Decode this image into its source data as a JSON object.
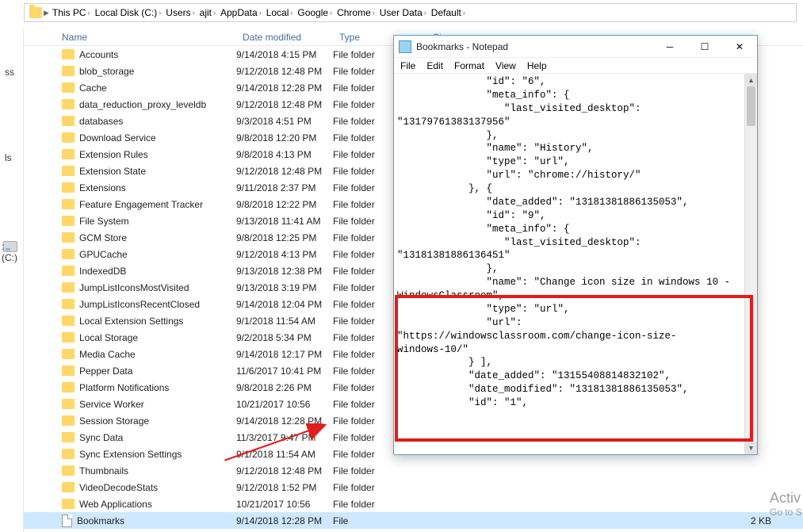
{
  "breadcrumb": {
    "items": [
      {
        "label": "This PC"
      },
      {
        "label": "Local Disk (C:)"
      },
      {
        "label": "Users"
      },
      {
        "label": "ajit"
      },
      {
        "label": "AppData"
      },
      {
        "label": "Local"
      },
      {
        "label": "Google"
      },
      {
        "label": "Chrome"
      },
      {
        "label": "User Data"
      },
      {
        "label": "Default"
      }
    ]
  },
  "sidebar": {
    "labels": {
      "ss": "ss",
      "ls": "ls",
      "cdisk": ": (C:)"
    }
  },
  "columns": {
    "name": "Name",
    "date": "Date modified",
    "type": "Type",
    "size": "Size"
  },
  "files": [
    {
      "icon": "folder",
      "name": "Accounts",
      "date": "9/14/2018 4:15 PM",
      "type": "File folder",
      "size": ""
    },
    {
      "icon": "folder",
      "name": "blob_storage",
      "date": "9/12/2018 12:48 PM",
      "type": "File folder",
      "size": ""
    },
    {
      "icon": "folder",
      "name": "Cache",
      "date": "9/14/2018 12:28 PM",
      "type": "File folder",
      "size": ""
    },
    {
      "icon": "folder",
      "name": "data_reduction_proxy_leveldb",
      "date": "9/12/2018 12:48 PM",
      "type": "File folder",
      "size": ""
    },
    {
      "icon": "folder",
      "name": "databases",
      "date": "9/3/2018 4:51 PM",
      "type": "File folder",
      "size": ""
    },
    {
      "icon": "folder",
      "name": "Download Service",
      "date": "9/8/2018 12:20 PM",
      "type": "File folder",
      "size": ""
    },
    {
      "icon": "folder",
      "name": "Extension Rules",
      "date": "9/8/2018 4:13 PM",
      "type": "File folder",
      "size": ""
    },
    {
      "icon": "folder",
      "name": "Extension State",
      "date": "9/12/2018 12:48 PM",
      "type": "File folder",
      "size": ""
    },
    {
      "icon": "folder",
      "name": "Extensions",
      "date": "9/11/2018 2:37 PM",
      "type": "File folder",
      "size": ""
    },
    {
      "icon": "folder",
      "name": "Feature Engagement Tracker",
      "date": "9/8/2018 12:22 PM",
      "type": "File folder",
      "size": ""
    },
    {
      "icon": "folder",
      "name": "File System",
      "date": "9/13/2018 11:41 AM",
      "type": "File folder",
      "size": ""
    },
    {
      "icon": "folder",
      "name": "GCM Store",
      "date": "9/8/2018 12:25 PM",
      "type": "File folder",
      "size": ""
    },
    {
      "icon": "folder",
      "name": "GPUCache",
      "date": "9/12/2018 4:13 PM",
      "type": "File folder",
      "size": ""
    },
    {
      "icon": "folder",
      "name": "IndexedDB",
      "date": "9/13/2018 12:38 PM",
      "type": "File folder",
      "size": ""
    },
    {
      "icon": "folder",
      "name": "JumpListIconsMostVisited",
      "date": "9/13/2018 3:19 PM",
      "type": "File folder",
      "size": ""
    },
    {
      "icon": "folder",
      "name": "JumpListIconsRecentClosed",
      "date": "9/14/2018 12:04 PM",
      "type": "File folder",
      "size": ""
    },
    {
      "icon": "folder",
      "name": "Local Extension Settings",
      "date": "9/1/2018 11:54 AM",
      "type": "File folder",
      "size": ""
    },
    {
      "icon": "folder",
      "name": "Local Storage",
      "date": "9/2/2018 5:34 PM",
      "type": "File folder",
      "size": ""
    },
    {
      "icon": "folder",
      "name": "Media Cache",
      "date": "9/14/2018 12:17 PM",
      "type": "File folder",
      "size": ""
    },
    {
      "icon": "folder",
      "name": "Pepper Data",
      "date": "11/6/2017 10:41 PM",
      "type": "File folder",
      "size": ""
    },
    {
      "icon": "folder",
      "name": "Platform Notifications",
      "date": "9/8/2018 2:26 PM",
      "type": "File folder",
      "size": ""
    },
    {
      "icon": "folder",
      "name": "Service Worker",
      "date": "10/21/2017 10:56",
      "type": "File folder",
      "size": ""
    },
    {
      "icon": "folder",
      "name": "Session Storage",
      "date": "9/14/2018 12:28 PM",
      "type": "File folder",
      "size": ""
    },
    {
      "icon": "folder",
      "name": "Sync Data",
      "date": "11/3/2017 9:47 PM",
      "type": "File folder",
      "size": ""
    },
    {
      "icon": "folder",
      "name": "Sync Extension Settings",
      "date": "9/1/2018 11:54 AM",
      "type": "File folder",
      "size": ""
    },
    {
      "icon": "folder",
      "name": "Thumbnails",
      "date": "9/12/2018 12:48 PM",
      "type": "File folder",
      "size": ""
    },
    {
      "icon": "folder",
      "name": "VideoDecodeStats",
      "date": "9/12/2018 1:52 PM",
      "type": "File folder",
      "size": ""
    },
    {
      "icon": "folder",
      "name": "Web Applications",
      "date": "10/21/2017 10:56",
      "type": "File folder",
      "size": ""
    },
    {
      "icon": "file",
      "name": "Bookmarks",
      "date": "9/14/2018 12:28 PM",
      "type": "File",
      "size": "2 KB",
      "selected": true
    }
  ],
  "notepad": {
    "title": "Bookmarks - Notepad",
    "menu": {
      "file": "File",
      "edit": "Edit",
      "format": "Format",
      "view": "View",
      "help": "Help"
    },
    "text": "               \"id\": \"6\",\n               \"meta_info\": {\n                  \"last_visited_desktop\":\n\"13179761383137956\"\n               },\n               \"name\": \"History\",\n               \"type\": \"url\",\n               \"url\": \"chrome://history/\"\n            }, {\n               \"date_added\": \"13181381886135053\",\n               \"id\": \"9\",\n               \"meta_info\": {\n                  \"last_visited_desktop\":\n\"13181381886136451\"\n               },\n               \"name\": \"Change icon size in windows 10 -\nWindowsClassroom\",\n               \"type\": \"url\",\n               \"url\":\n\"https://windowsclassroom.com/change-icon-size-\nwindows-10/\"\n            } ],\n            \"date_added\": \"13155408814832102\",\n            \"date_modified\": \"13181381886135053\",\n            \"id\": \"1\","
  },
  "activation": {
    "l1": "Activ",
    "l2": "Go to S"
  }
}
